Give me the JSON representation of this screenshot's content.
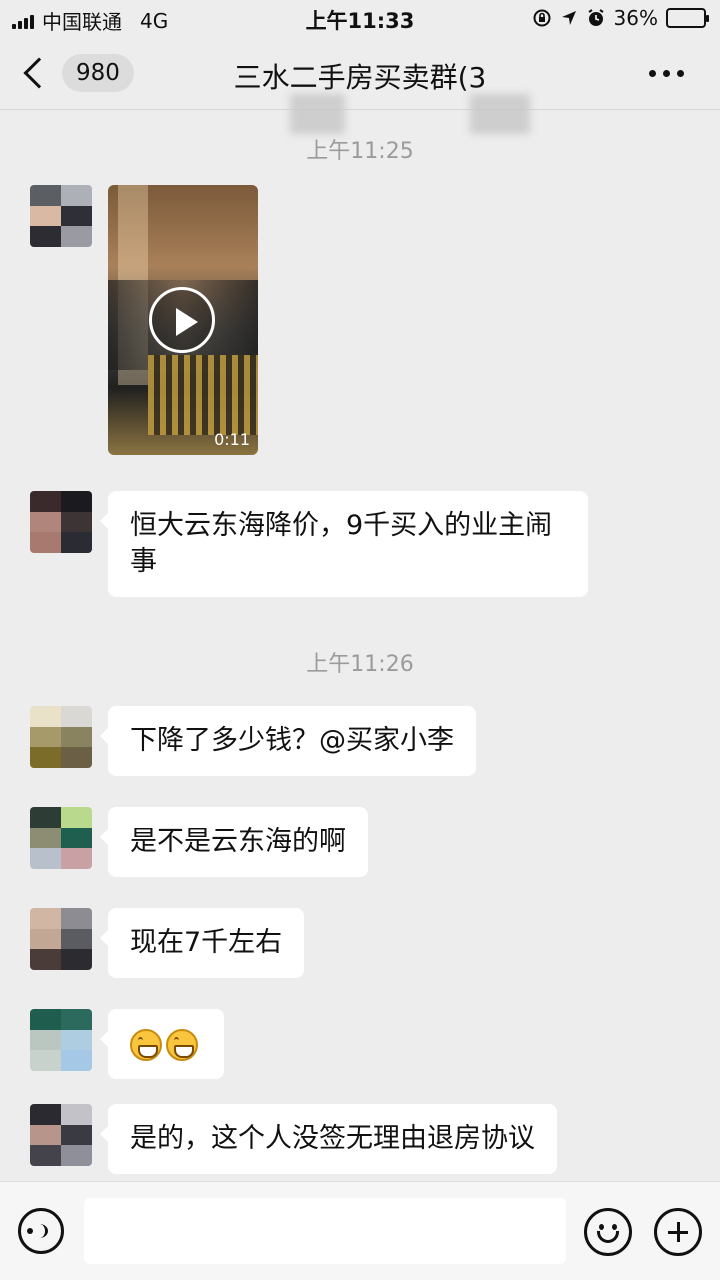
{
  "status_bar": {
    "carrier": "中国联通",
    "network": "4G",
    "time": "上午11:33",
    "battery_percent": "36%",
    "battery_level": 0.36,
    "icons": [
      "signal-icon",
      "orientation-lock-icon",
      "location-icon",
      "alarm-icon",
      "battery-icon"
    ]
  },
  "nav": {
    "unread_count": "980",
    "title": "三水二手房买卖群(3",
    "icons": [
      "back-chevron-icon",
      "more-dots-icon"
    ]
  },
  "chat": {
    "groups": [
      {
        "time": "上午11:25",
        "messages": [
          {
            "type": "video",
            "duration": "0:11"
          },
          {
            "type": "text",
            "text": "恒大云东海降价，9千买入的业主闹事"
          }
        ]
      },
      {
        "time": "上午11:26",
        "messages": [
          {
            "type": "text",
            "text": "下降了多少钱？@买家小李"
          },
          {
            "type": "text",
            "text": "是不是云东海的啊"
          },
          {
            "type": "text",
            "text": "现在7千左右"
          },
          {
            "type": "emoji",
            "emoji": [
              "grin-emoji",
              "grin-emoji"
            ]
          },
          {
            "type": "text",
            "text": "是的，这个人没签无理由退房协议"
          }
        ]
      }
    ]
  },
  "input_bar": {
    "value": "",
    "icons": [
      "voice-icon",
      "emoji-icon",
      "plus-icon"
    ]
  },
  "colors": {
    "background": "#ededed",
    "bubble": "#ffffff",
    "timestamp": "#9b9b9b"
  }
}
